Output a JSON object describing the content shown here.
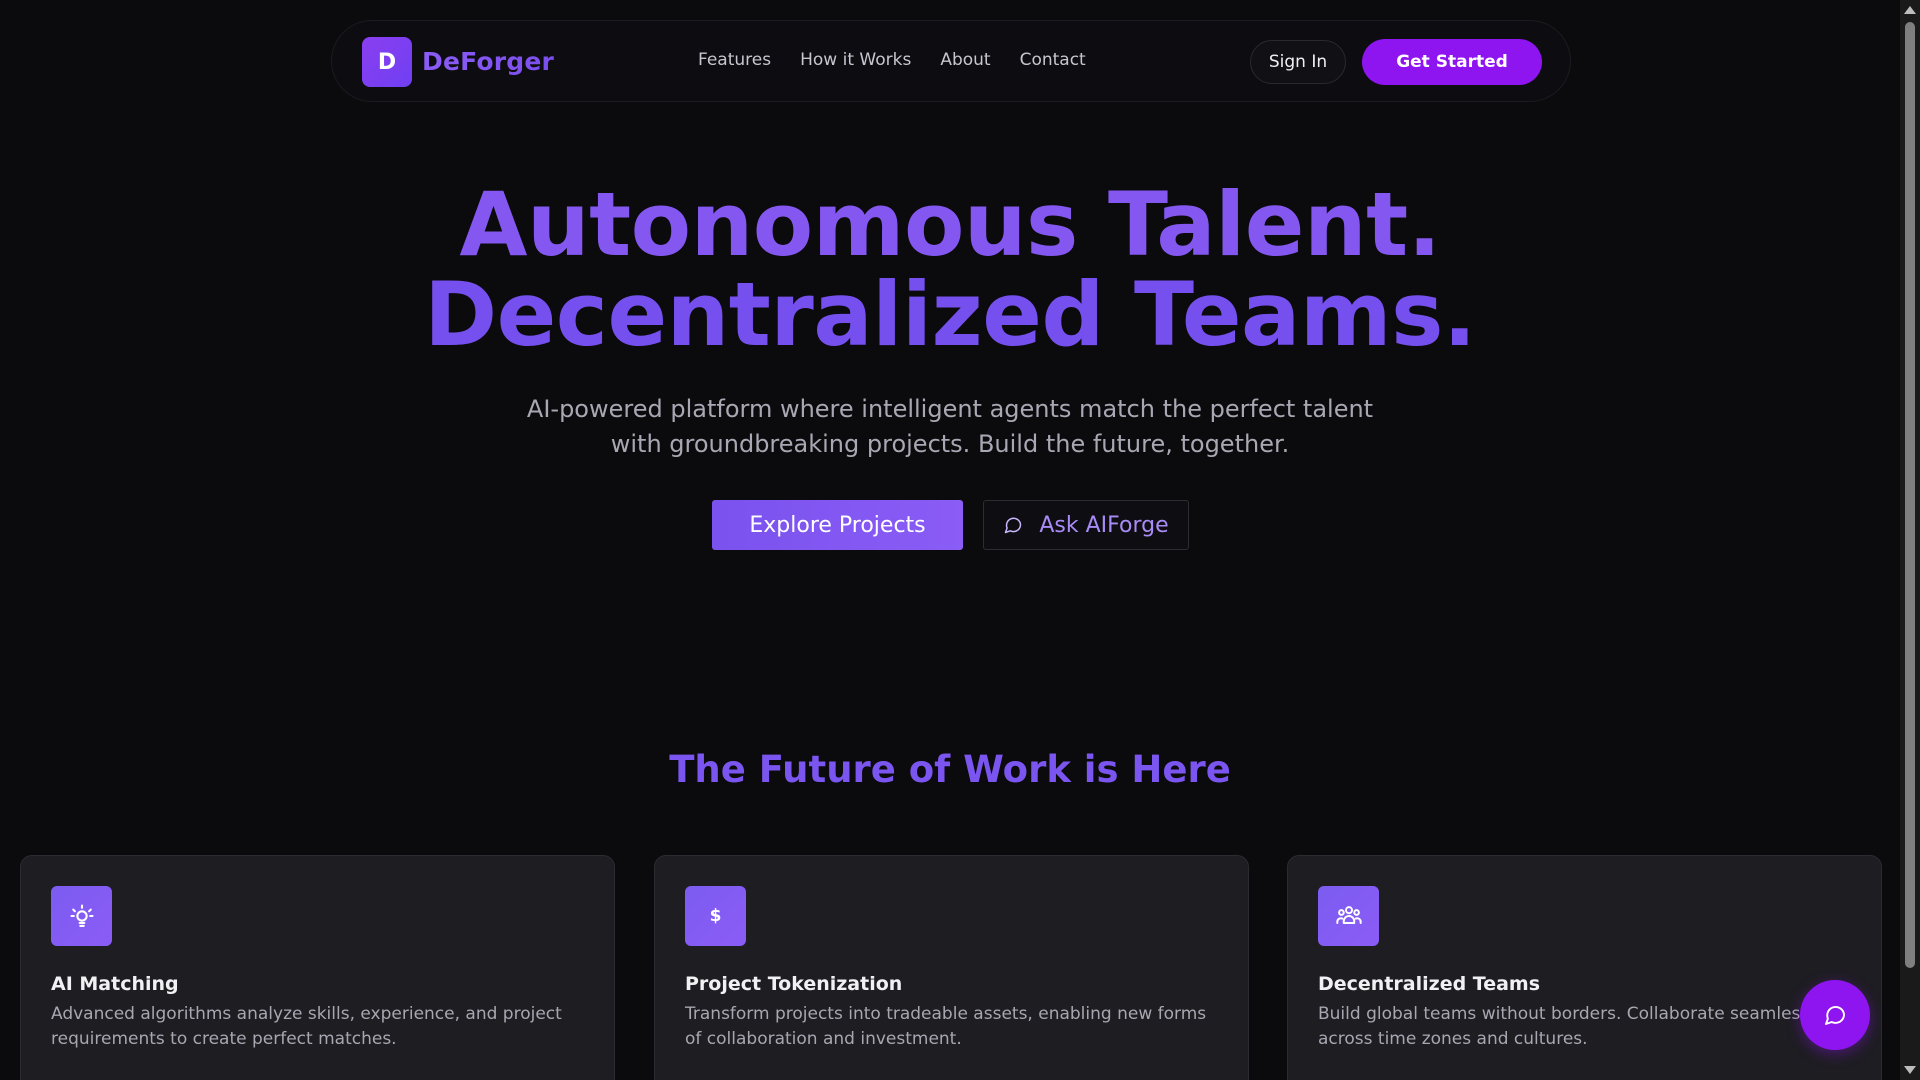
{
  "nav": {
    "logo_letter": "D",
    "brand": "DeForger",
    "links": [
      "Features",
      "How it Works",
      "About",
      "Contact"
    ],
    "sign_in": "Sign In",
    "get_started": "Get Started"
  },
  "hero": {
    "title_line1": "Autonomous Talent.",
    "title_line2": "Decentralized Teams.",
    "subtitle": "AI-powered platform where intelligent agents match the perfect talent with groundbreaking projects. Build the future, together.",
    "explore_label": "Explore Projects",
    "ask_label": "Ask AIForge"
  },
  "features": {
    "heading": "The Future of Work is Here",
    "cards": [
      {
        "icon": "lightbulb-icon",
        "title": "AI Matching",
        "desc": "Advanced algorithms analyze skills, experience, and project requirements to create perfect matches."
      },
      {
        "icon": "dollar-icon",
        "icon_text": "$",
        "title": "Project Tokenization",
        "desc": "Transform projects into tradeable assets, enabling new forms of collaboration and investment."
      },
      {
        "icon": "team-icon",
        "title": "Decentralized Teams",
        "desc": "Build global teams without borders. Collaborate seamlessly across time zones and cultures."
      }
    ]
  },
  "colors": {
    "background": "#0b0a0c",
    "accent": "#8e14f0",
    "gradient_purple": "#8b5cf6",
    "card_bg": "#1e1d22"
  }
}
